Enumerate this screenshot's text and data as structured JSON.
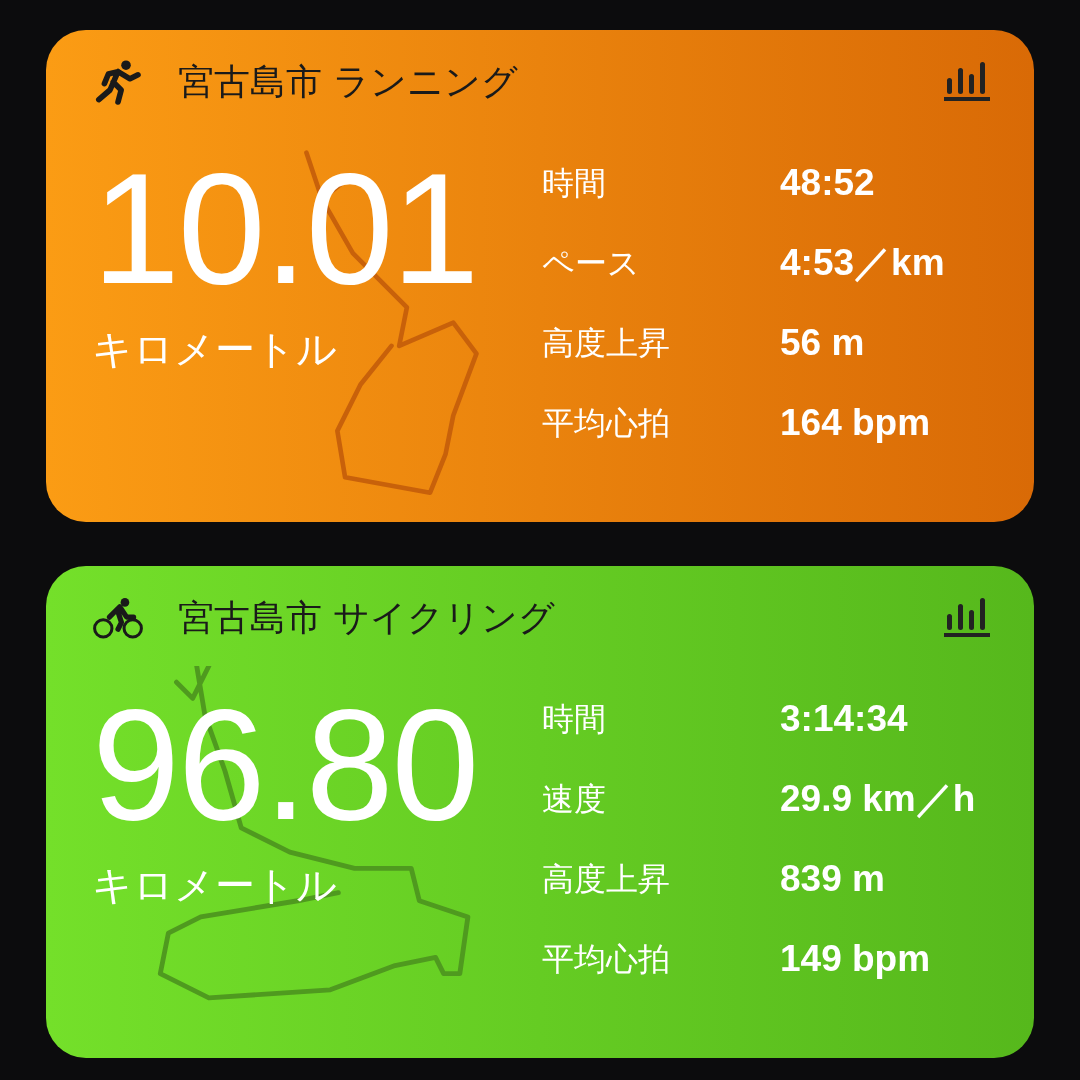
{
  "workouts": [
    {
      "kind": "running",
      "title": "宮古島市 ランニング",
      "distance": "10.01",
      "unit": "キロメートル",
      "stats": [
        {
          "label": "時間",
          "value": "48:52"
        },
        {
          "label": "ペース",
          "value": "4:53／km"
        },
        {
          "label": "高度上昇",
          "value": "56 m"
        },
        {
          "label": "平均心拍",
          "value": "164 bpm"
        }
      ]
    },
    {
      "kind": "cycling",
      "title": "宮古島市 サイクリング",
      "distance": "96.80",
      "unit": "キロメートル",
      "stats": [
        {
          "label": "時間",
          "value": "3:14:34"
        },
        {
          "label": "速度",
          "value": "29.9 km／h"
        },
        {
          "label": "高度上昇",
          "value": "839 m"
        },
        {
          "label": "平均心拍",
          "value": "149 bpm"
        }
      ]
    }
  ]
}
